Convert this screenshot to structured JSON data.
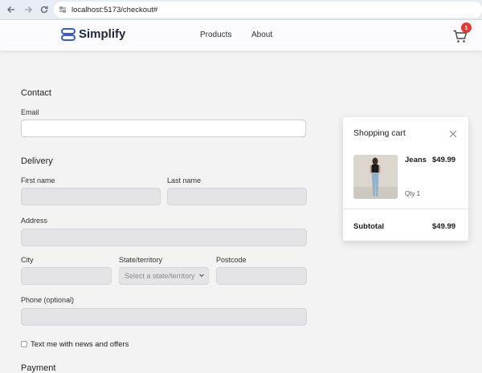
{
  "browser": {
    "url": "localhost:5173/checkout#",
    "icons": {
      "back": "arrow-left-icon",
      "forward": "arrow-right-icon",
      "reload": "reload-icon",
      "site": "site-settings-icon"
    }
  },
  "header": {
    "logo_text": "Simplify",
    "nav": {
      "products": "Products",
      "about": "About"
    },
    "cart_count": "1",
    "brand_color": "#3a5bd9"
  },
  "form": {
    "contact_title": "Contact",
    "email_label": "Email",
    "delivery_title": "Delivery",
    "first_name_label": "First name",
    "last_name_label": "Last name",
    "address_label": "Address",
    "city_label": "City",
    "state_label": "State/territory",
    "state_placeholder": "Select a state/territory",
    "postcode_label": "Postcode",
    "phone_label": "Phone (optional)",
    "newsletter_label": "Text me with news and offers",
    "payment_title": "Payment"
  },
  "cart": {
    "title": "Shopping cart",
    "item": {
      "name": "Jeans",
      "price": "$49.99",
      "qty": "Qty 1"
    },
    "subtotal_label": "Subtotal",
    "subtotal_value": "$49.99"
  }
}
